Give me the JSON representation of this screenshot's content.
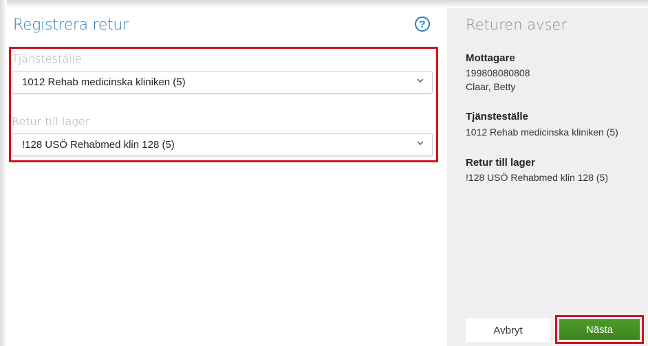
{
  "form": {
    "title": "Registrera retur",
    "help_glyph": "?",
    "help_icon": "help-circle-icon",
    "fields": [
      {
        "label": "Tjänsteställe",
        "value": "1012 Rehab medicinska kliniken (5)"
      },
      {
        "label": "Retur till lager",
        "value": "!128 USÖ Rehabmed klin 128 (5)"
      }
    ]
  },
  "summary": {
    "title": "Returen avser",
    "recipient": {
      "heading": "Mottagare",
      "id": "199808080808",
      "name": "Claar, Betty"
    },
    "service": {
      "heading": "Tjänsteställe",
      "value": "1012 Rehab medicinska kliniken (5)"
    },
    "warehouse": {
      "heading": "Retur till lager",
      "value": "!128 USÖ Rehabmed klin 128 (5)"
    }
  },
  "actions": {
    "cancel_label": "Avbryt",
    "next_label": "Nästa"
  },
  "colors": {
    "accent": "#2b7fb8",
    "highlight": "#d0121b",
    "primary_button": "#3e8420"
  }
}
